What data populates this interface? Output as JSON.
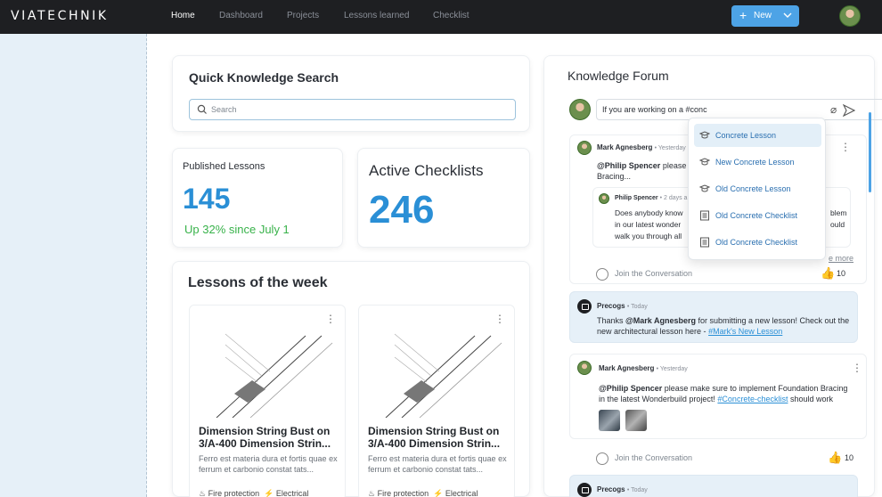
{
  "app": {
    "logo": "VIATECHNIK"
  },
  "nav": {
    "items": [
      {
        "label": "Home",
        "active": true
      },
      {
        "label": "Dashboard"
      },
      {
        "label": "Projects"
      },
      {
        "label": "Lessons learned"
      },
      {
        "label": "Checklist"
      }
    ],
    "new_button": "New"
  },
  "quick_search": {
    "title": "Quick Knowledge Search",
    "placeholder": "Search"
  },
  "published": {
    "title": "Published Lessons",
    "count": "145",
    "trend": "Up 32% since July 1"
  },
  "active_checklists": {
    "title": "Active Checklists",
    "count": "246"
  },
  "lessons_week": {
    "title": "Lessons of the week",
    "cards": [
      {
        "title": "Dimension String Bust on 3/A-400 Dimension Strin...",
        "desc": "Ferro est materia dura et fortis quae ex ferrum et carbonio constat tats...",
        "tag1": "Fire protection",
        "tag2": "Electrical"
      },
      {
        "title": "Dimension String Bust on 3/A-400 Dimension Strin...",
        "desc": "Ferro est materia dura et fortis quae ex ferrum et carbonio constat tats...",
        "tag1": "Fire protection",
        "tag2": "Electrical"
      }
    ]
  },
  "forum": {
    "title": "Knowledge Forum",
    "input_value": "If you are working on a #conc",
    "dropdown": [
      {
        "label": "Concrete Lesson",
        "icon": "graduation-cap-icon",
        "highlighted": true
      },
      {
        "label": "New Concrete Lesson",
        "icon": "graduation-cap-icon"
      },
      {
        "label": "Old Concrete Lesson",
        "icon": "graduation-cap-icon"
      },
      {
        "label": "Old Concrete Checklist",
        "icon": "checklist-icon"
      },
      {
        "label": "Old Concrete Checklist",
        "icon": "checklist-icon"
      }
    ],
    "post1": {
      "author": "Mark Agnesberg",
      "when": "Yesterday",
      "mention": "@Philip Spencer",
      "text_a": "please m",
      "text_b": "Bracing...",
      "reply_author": "Philip Spencer",
      "reply_when": "2 days a",
      "reply_lines": [
        "Does anybody know",
        "in our latest wonder",
        "walk you through all"
      ],
      "reply_right": [
        "blem",
        "ould"
      ],
      "see_more": "e more",
      "join": "Join the Conversation",
      "likes": "10"
    },
    "post2": {
      "author": "Precogs",
      "when": "Today",
      "text_a": "Thanks ",
      "mention": "@Mark Agnesberg",
      "text_b": " for submitting a new lesson! Check out the",
      "text_c": "new architectural lesson here - ",
      "link": "#Mark's New Lesson"
    },
    "post3": {
      "author": "Mark Agnesberg",
      "when": "Yesterday",
      "mention": "@Philip Spencer",
      "text_a": " please make sure to implement Foundation Bracing",
      "text_b": "in the latest Wonderbuild project! ",
      "link": "#Concrete-checklist",
      "text_c": " should work",
      "join": "Join the Conversation",
      "likes": "10"
    },
    "post4": {
      "author": "Precogs",
      "when": "Today"
    }
  },
  "colors": {
    "accent": "#2a8fd6",
    "positive": "#38b24a",
    "nav_bg": "#1e1f22"
  }
}
